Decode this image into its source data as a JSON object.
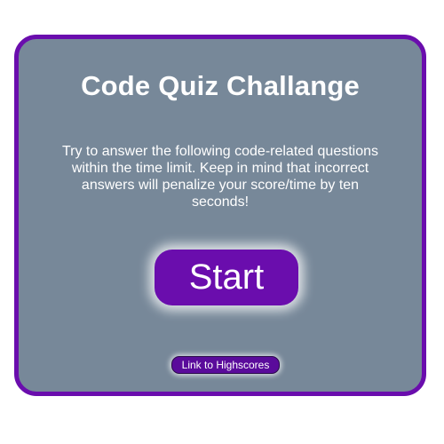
{
  "quiz": {
    "title": "Code Quiz Challange",
    "instructions": "Try to answer the following code-related questions within the time limit. Keep in mind that incorrect answers will penalize your score/time by ten seconds!",
    "start_label": "Start",
    "highscores_label": "Link to Highscores"
  },
  "colors": {
    "card_background": "#778899",
    "accent_purple": "#6a0dad",
    "text": "#ffffff"
  }
}
